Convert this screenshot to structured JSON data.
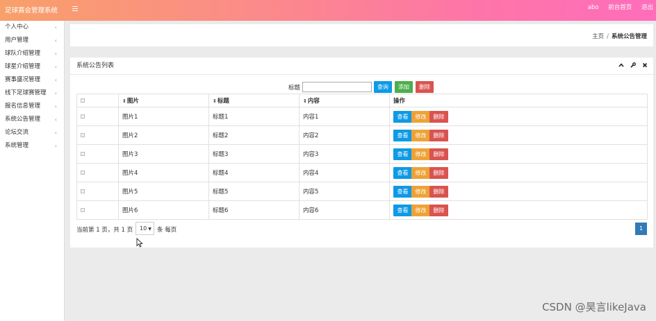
{
  "app": {
    "title": "足球赛会管理系统"
  },
  "topbar": {
    "user": "abo",
    "links": [
      "前台首页",
      "退出"
    ]
  },
  "sidebar": {
    "items": [
      {
        "label": "个人中心"
      },
      {
        "label": "用户管理"
      },
      {
        "label": "球队介绍管理"
      },
      {
        "label": "球星介绍管理"
      },
      {
        "label": "赛事盛况管理"
      },
      {
        "label": "线下足球赛管理"
      },
      {
        "label": "报名信息管理"
      },
      {
        "label": "系统公告管理"
      },
      {
        "label": "论坛交流"
      },
      {
        "label": "系统管理"
      }
    ],
    "chevron": "‹"
  },
  "breadcrumb": {
    "home": "主页",
    "separator": "/",
    "current": "系统公告管理"
  },
  "panel": {
    "title": "系统公告列表",
    "tools": [
      "chevron-up-icon",
      "wrench-icon",
      "close-icon"
    ]
  },
  "search": {
    "label": "标题",
    "value": "",
    "query_label": "查询",
    "add_label": "添加",
    "delete_label": "删除"
  },
  "table": {
    "columns": [
      "图片",
      "标题",
      "内容",
      "操作"
    ],
    "rows": [
      {
        "image": "图片1",
        "title": "标题1",
        "content": "内容1"
      },
      {
        "image": "图片2",
        "title": "标题2",
        "content": "内容2"
      },
      {
        "image": "图片3",
        "title": "标题3",
        "content": "内容3"
      },
      {
        "image": "图片4",
        "title": "标题4",
        "content": "内容4"
      },
      {
        "image": "图片5",
        "title": "标题5",
        "content": "内容5"
      },
      {
        "image": "图片6",
        "title": "标题6",
        "content": "内容6"
      }
    ],
    "actions": {
      "view": "查看",
      "edit": "修改",
      "delete": "删除"
    }
  },
  "pagination": {
    "summary": "当前第 1 页，共 1 页",
    "page_size": "10",
    "per_page_label": "条 每页",
    "current_page": "1"
  },
  "watermark": "CSDN @昊言likeJava",
  "colors": {
    "topbar_start": "#f8a06a",
    "topbar_end": "#ff6dbb",
    "primary": "#0d9ae6",
    "success": "#4cae4c",
    "warning": "#eea236",
    "danger": "#d9534f",
    "page_active": "#337ab7"
  }
}
